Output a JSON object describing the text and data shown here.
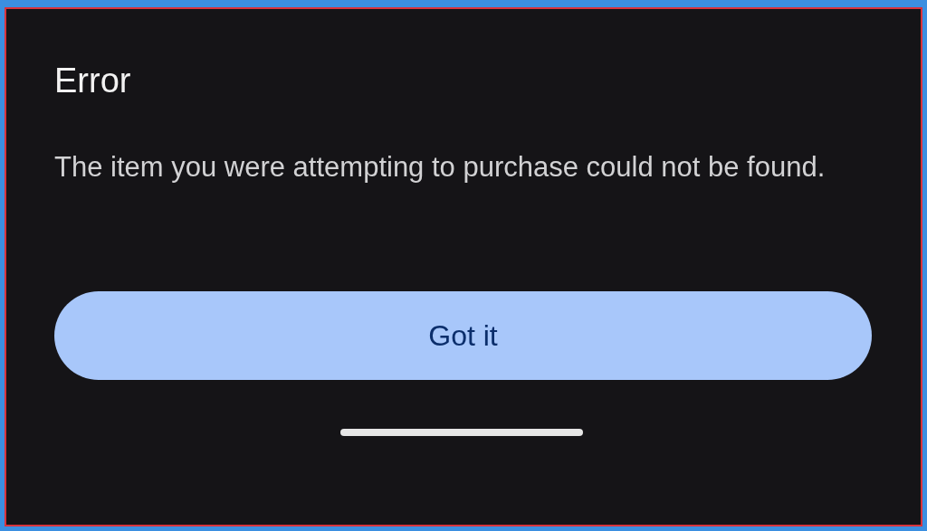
{
  "dialog": {
    "title": "Error",
    "message": "The item you were attempting to purchase could not be found.",
    "button": "Got it"
  }
}
